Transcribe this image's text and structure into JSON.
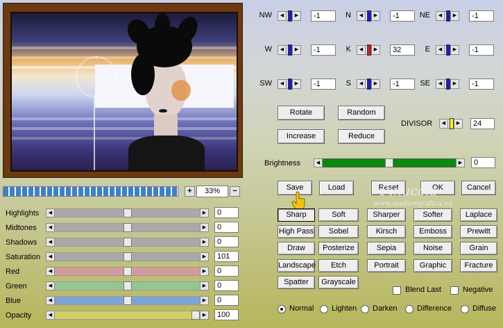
{
  "zoom": {
    "plus": "+",
    "minus": "−",
    "value": "33%"
  },
  "adjust": [
    {
      "label": "Highlights",
      "value": "0",
      "position": 0.5,
      "color": "#a9a9a9"
    },
    {
      "label": "Midtones",
      "value": "0",
      "position": 0.5,
      "color": "#a9a9a9"
    },
    {
      "label": "Shadows",
      "value": "0",
      "position": 0.5,
      "color": "#a9a9a9"
    },
    {
      "label": "Saturation",
      "value": "101",
      "position": 0.5,
      "color": "#a9a9a9"
    },
    {
      "label": "Red",
      "value": "0",
      "position": 0.5,
      "color": "#d59b9b"
    },
    {
      "label": "Green",
      "value": "0",
      "position": 0.5,
      "color": "#92c692"
    },
    {
      "label": "Blue",
      "value": "0",
      "position": 0.5,
      "color": "#7ca4d4"
    },
    {
      "label": "Opacity",
      "value": "100",
      "position": 1.0,
      "color": "#cfcf66"
    }
  ],
  "kernel": [
    {
      "label": "NW",
      "value": "-1",
      "knob_color": "#1a1ad8"
    },
    {
      "label": "N",
      "value": "-1",
      "knob_color": "#1a1ad8"
    },
    {
      "label": "NE",
      "value": "-1",
      "knob_color": "#1a1ad8"
    },
    {
      "label": "W",
      "value": "-1",
      "knob_color": "#1a1ad8"
    },
    {
      "label": "K",
      "value": "32",
      "knob_color": "#d81a1a"
    },
    {
      "label": "E",
      "value": "-1",
      "knob_color": "#1a1ad8"
    },
    {
      "label": "SW",
      "value": "-1",
      "knob_color": "#1a1ad8"
    },
    {
      "label": "S",
      "value": "-1",
      "knob_color": "#1a1ad8"
    },
    {
      "label": "SE",
      "value": "-1",
      "knob_color": "#1a1ad8"
    }
  ],
  "buttons": {
    "rotate": "Rotate",
    "random": "Random",
    "increase": "Increase",
    "reduce": "Reduce",
    "save": "Save",
    "load": "Load",
    "reset": "Reset",
    "ok": "OK",
    "cancel": "Cancel"
  },
  "divisor": {
    "label": "DIVISOR",
    "value": "24",
    "knob_color": "#ffff00"
  },
  "brightness": {
    "label": "Brightness",
    "value": "0",
    "position": 0.5
  },
  "presets": [
    [
      "Sharp",
      "Soft",
      "Sharper",
      "Softer",
      "Laplace"
    ],
    [
      "High Pass",
      "Sobel",
      "Kirsch",
      "Emboss",
      "Prewitt"
    ],
    [
      "Draw",
      "Posterize",
      "Sepia",
      "Noise",
      "Grain"
    ],
    [
      "Landscape",
      "Etch",
      "Portrait",
      "Graphic",
      "Fracture"
    ],
    [
      "Spatter",
      "Grayscale"
    ]
  ],
  "options": {
    "blend_last": "Blend Last",
    "negative": "Negative"
  },
  "modes": [
    "Normal",
    "Lighten",
    "Darken",
    "Difference",
    "Diffuse"
  ],
  "selected_mode": "Normal",
  "watermark": {
    "title": "Pinuccia",
    "url": "www.madiregrafica.eu"
  }
}
